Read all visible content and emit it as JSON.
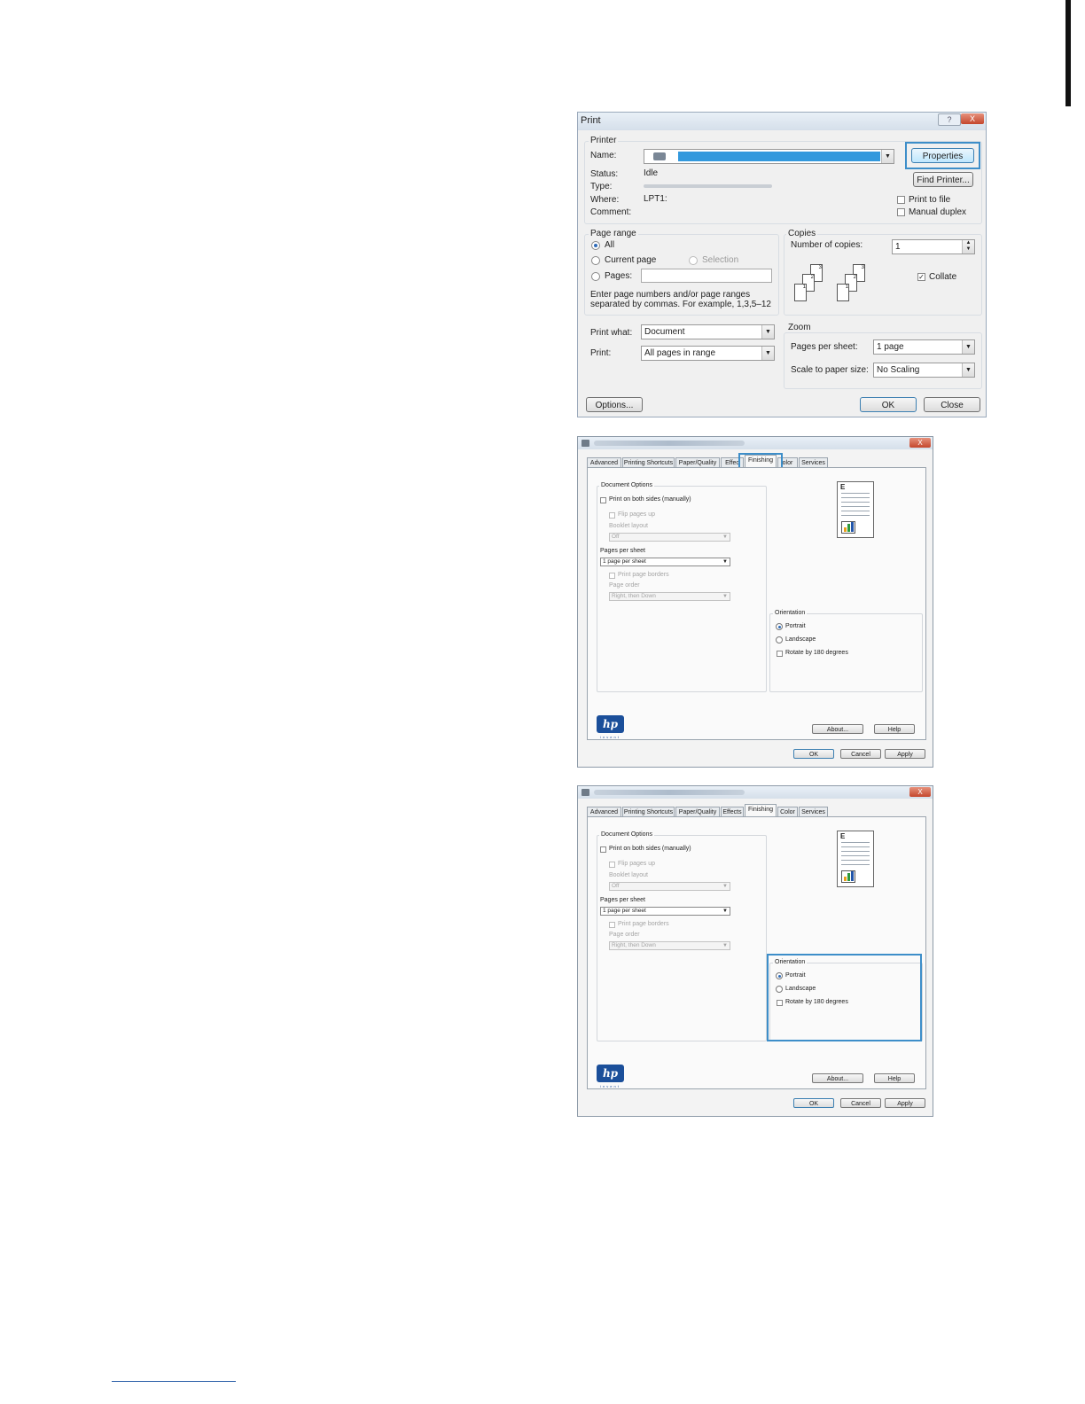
{
  "print": {
    "title": "Print",
    "help": "?",
    "close": "X",
    "printer": {
      "legend": "Printer",
      "name_label": "Name:",
      "status_label": "Status:",
      "status_value": "Idle",
      "type_label": "Type:",
      "where_label": "Where:",
      "where_value": "LPT1:",
      "comment_label": "Comment:",
      "properties": "Properties",
      "find_printer": "Find Printer...",
      "print_to_file": "Print to file",
      "manual_duplex": "Manual duplex"
    },
    "page_range": {
      "legend": "Page range",
      "all": "All",
      "current_page": "Current page",
      "selection": "Selection",
      "pages": "Pages:",
      "hint1": "Enter page numbers and/or page ranges",
      "hint2": "separated by commas.  For example, 1,3,5–12"
    },
    "copies": {
      "legend": "Copies",
      "number_label": "Number of copies:",
      "number_value": "1",
      "collate": "Collate",
      "collate_checked": true,
      "sheets": [
        "3",
        "2",
        "1",
        "3",
        "2",
        "1"
      ]
    },
    "print_what": {
      "label": "Print what:",
      "value": "Document"
    },
    "print_sel": {
      "label": "Print:",
      "value": "All pages in range"
    },
    "zoom": {
      "legend": "Zoom",
      "pps_label": "Pages per sheet:",
      "pps_value": "1 page",
      "scale_label": "Scale to paper size:",
      "scale_value": "No Scaling"
    },
    "options": "Options...",
    "ok": "OK",
    "close_btn": "Close"
  },
  "props": {
    "close": "X",
    "tabs": [
      "Advanced",
      "Printing Shortcuts",
      "Paper/Quality",
      "Effects",
      "Finishing",
      "Color",
      "Services"
    ],
    "tabs_top_first": [
      "Advanced",
      "Printing Shortcuts",
      "Paper/Quality",
      "Effec",
      "Finishing",
      "olor",
      "Services"
    ],
    "doc_options": {
      "legend": "Document Options",
      "both_sides": "Print on both sides (manually)",
      "flip_pages": "Flip pages up",
      "booklet_label": "Booklet layout",
      "booklet_value": "Off",
      "pps_label": "Pages per sheet",
      "pps_value": "1 page per sheet",
      "borders": "Print page borders",
      "order_label": "Page order",
      "order_value": "Right, then Down"
    },
    "orientation": {
      "legend": "Orientation",
      "portrait": "Portrait",
      "landscape": "Landscape",
      "rotate": "Rotate by 180 degrees"
    },
    "preview_letter": "E",
    "logo_text": "hp",
    "logo_sub": "invent",
    "about": "About...",
    "help": "Help",
    "ok": "OK",
    "cancel": "Cancel",
    "apply": "Apply"
  }
}
